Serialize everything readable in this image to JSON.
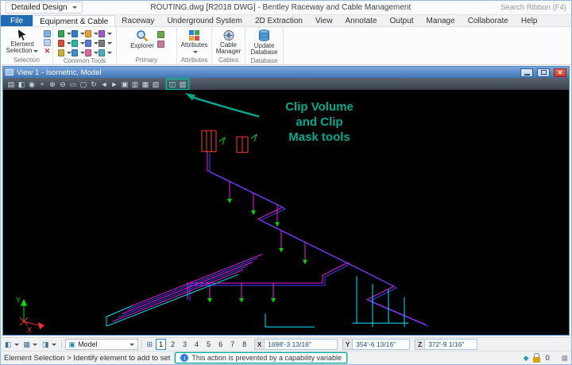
{
  "titlebar": {
    "workflow": "Detailed Design",
    "title": "ROUTING.dwg [R2018 DWG] - Bentley Raceway and Cable Management",
    "search_placeholder": "Search Ribbon (F4)"
  },
  "ribbon": {
    "tabs": [
      "File",
      "Equipment & Cable",
      "Raceway",
      "Underground System",
      "2D Extraction",
      "View",
      "Annotate",
      "Output",
      "Manage",
      "Collaborate",
      "Help"
    ],
    "selection": {
      "label": "Selection",
      "element_selection": "Element Selection"
    },
    "common_tools": {
      "label": "Common Tools"
    },
    "primary": {
      "label": "Primary",
      "explorer": "Explorer"
    },
    "attributes": {
      "label": "Attributes",
      "button": "Attributes"
    },
    "cables": {
      "label": "Cables",
      "cable_manager": "Cable Manager"
    },
    "database": {
      "label": "Database",
      "update_database": "Update Database"
    }
  },
  "view_window": {
    "title": "View 1 - Isometric, Model",
    "toolbar_glyphs": [
      "▤",
      "◧",
      "◉",
      "+",
      "⊕",
      "⊖",
      "▭",
      "▢",
      "↻",
      "◄",
      "►",
      "▣",
      "▥",
      "▦",
      "▧",
      "◫",
      "▨"
    ]
  },
  "annotation": {
    "line1": "Clip Volume",
    "line2": "and Clip",
    "line3": "Mask tools"
  },
  "canvas": {
    "axis_x": "X",
    "axis_y": "Y"
  },
  "bottombar": {
    "model": "Model",
    "view_numbers": [
      "1",
      "2",
      "3",
      "4",
      "5",
      "6",
      "7",
      "8"
    ],
    "x_label": "X",
    "x_value": "1698'-3 13/16\"",
    "y_label": "Y",
    "y_value": "354'-6 13/16\"",
    "z_label": "Z",
    "z_value": "372'-9 1/16\""
  },
  "statusbar": {
    "prompt": "Element Selection > Identify element to add to set",
    "message": "This action is prevented by a capability variable",
    "count": "0"
  },
  "icons": {
    "close": "✕",
    "info": "i",
    "view_group": "⊞",
    "snap": "◆",
    "grip": "▦",
    "vb1": "◧",
    "vb2": "▦",
    "vb3": "◨",
    "model": "▣"
  },
  "colors": {
    "teal_accent": "#00a98f",
    "file_tab_blue": "#1f6cb5",
    "close_red": "#cc3a28"
  }
}
